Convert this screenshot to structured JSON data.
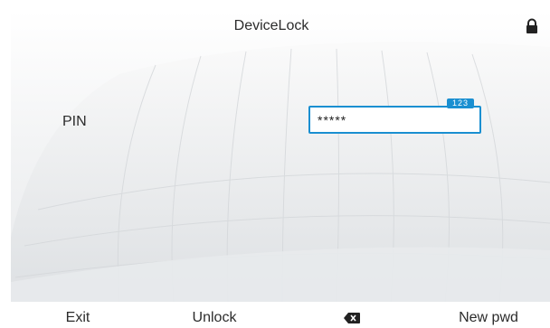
{
  "header": {
    "title": "DeviceLock",
    "lock_icon": "lock-icon"
  },
  "form": {
    "pin_label": "PIN",
    "pin_value": "*****",
    "input_mode_badge": "123"
  },
  "softkeys": {
    "exit_label": "Exit",
    "unlock_label": "Unlock",
    "backspace_icon": "backspace-icon",
    "new_pwd_label": "New pwd"
  },
  "colors": {
    "accent": "#1a8fd1",
    "text": "#2b2b2b"
  }
}
